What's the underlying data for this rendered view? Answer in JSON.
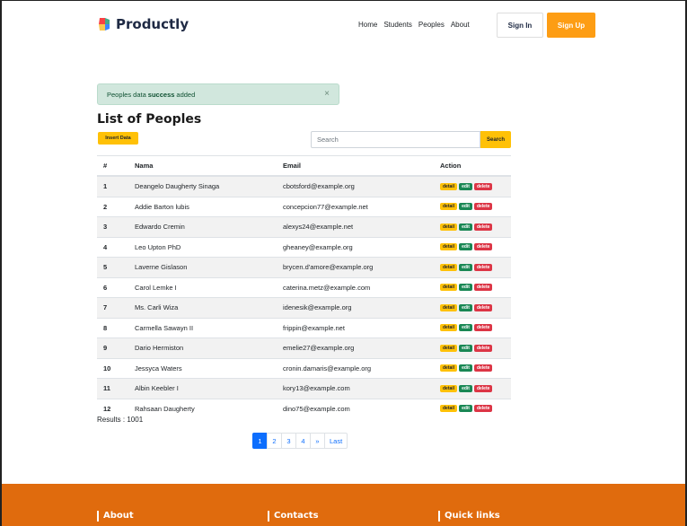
{
  "brand": {
    "name": "Productly"
  },
  "nav": {
    "items": [
      "Home",
      "Students",
      "Peoples",
      "About"
    ],
    "signin_label": "Sign In",
    "signup_label": "Sign Up"
  },
  "alert": {
    "before": "Peoples data",
    "bold": "success",
    "after": "added",
    "close": "×"
  },
  "page": {
    "title": "List of Peoples",
    "insert_label": "Insert Data"
  },
  "search": {
    "placeholder": "Search",
    "button_label": "Search"
  },
  "table": {
    "headers": [
      "#",
      "Nama",
      "Email",
      "Action"
    ],
    "actions": {
      "detail": "detail",
      "edit": "edit",
      "delete": "delete"
    },
    "rows": [
      {
        "no": "1",
        "name": "Deangelo Daugherty Sinaga",
        "email": "cbotsford@example.org"
      },
      {
        "no": "2",
        "name": "Addie Barton lubis",
        "email": "concepcion77@example.net"
      },
      {
        "no": "3",
        "name": "Edwardo Cremin",
        "email": "alexys24@example.net"
      },
      {
        "no": "4",
        "name": "Leo Upton PhD",
        "email": "gheaney@example.org"
      },
      {
        "no": "5",
        "name": "Laverne Gislason",
        "email": "brycen.d'amore@example.org"
      },
      {
        "no": "6",
        "name": "Carol Lemke I",
        "email": "caterina.metz@example.com"
      },
      {
        "no": "7",
        "name": "Ms. Carli Wiza",
        "email": "idenesik@example.org"
      },
      {
        "no": "8",
        "name": "Carmella Sawayn II",
        "email": "frippin@example.net"
      },
      {
        "no": "9",
        "name": "Dario Hermiston",
        "email": "emelie27@example.org"
      },
      {
        "no": "10",
        "name": "Jessyca Waters",
        "email": "cronin.damaris@example.org"
      },
      {
        "no": "11",
        "name": "Albin Keebler I",
        "email": "kory13@example.com"
      },
      {
        "no": "12",
        "name": "Rahsaan Daugherty",
        "email": "dino75@example.com"
      }
    ]
  },
  "results": "Results : 1001",
  "pagination": {
    "pages": [
      "1",
      "2",
      "3",
      "4",
      "»",
      "Last"
    ],
    "active": "1"
  },
  "footer": {
    "about": "About",
    "contacts": "Contacts",
    "quick_links": "Quick links"
  },
  "colors": {
    "accent": "#fd9d14",
    "footer": "#e06b0d",
    "primary": "#0d6efd"
  }
}
